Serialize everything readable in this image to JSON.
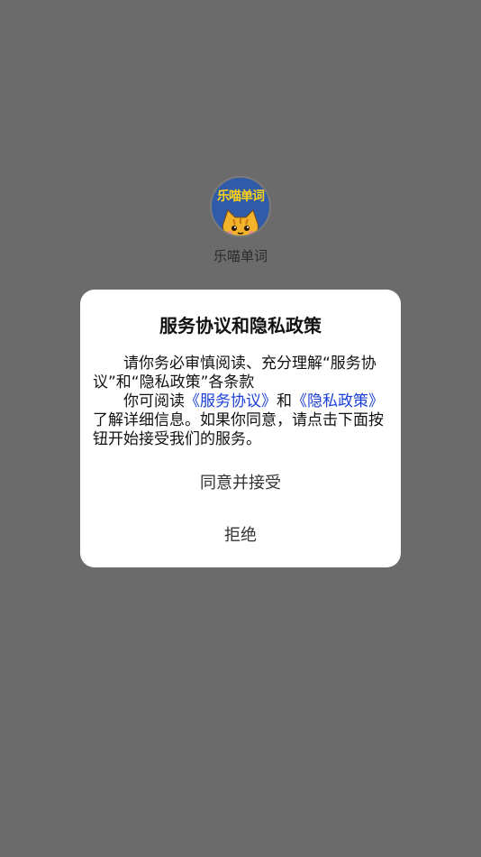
{
  "app": {
    "name": "乐喵单词",
    "logo_text": "乐喵单词"
  },
  "dialog": {
    "title": "服务协议和隐私政策",
    "paragraph1": "请你务必审慎阅读、充分理解“服务协议”和“隐私政策”各条款",
    "paragraph2_prefix": "你可阅读",
    "service_link": "《服务协议》",
    "conjunction": "和",
    "privacy_link": "《隐私政策》",
    "paragraph2_suffix": "了解详细信息。如果你同意，请点击下面按钮开始接受我们的服务。",
    "accept_label": "同意并接受",
    "reject_label": "拒绝"
  },
  "colors": {
    "overlay": "#6b6b6b",
    "link": "#1a3fd6",
    "logo_bg": "#2f5ba8",
    "logo_text": "#ffd21a"
  },
  "icons": {
    "logo": "cat-logo-icon"
  }
}
